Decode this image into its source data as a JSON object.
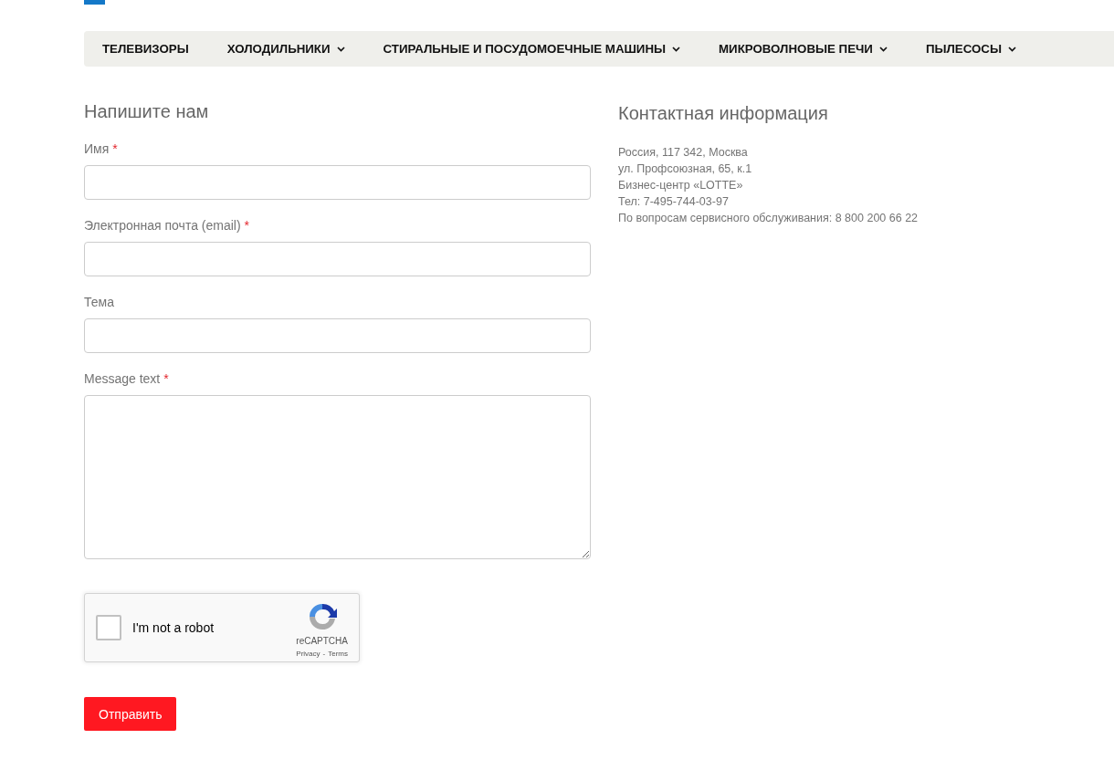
{
  "nav": [
    {
      "label": "ТЕЛЕВИЗОРЫ",
      "has_submenu": false
    },
    {
      "label": "ХОЛОДИЛЬНИКИ",
      "has_submenu": true
    },
    {
      "label": "СТИРАЛЬНЫЕ И ПОСУДОМОЕЧНЫЕ МАШИНЫ",
      "has_submenu": true
    },
    {
      "label": "МИКРОВОЛНОВЫЕ ПЕЧИ",
      "has_submenu": true
    },
    {
      "label": "ПЫЛЕСОСЫ",
      "has_submenu": true
    }
  ],
  "form": {
    "title": "Напишите нам",
    "fields": [
      {
        "kind": "input",
        "label": "Имя",
        "required_mark": "*"
      },
      {
        "kind": "input",
        "label": "Электронная почта (email)",
        "required_mark": "*"
      },
      {
        "kind": "input",
        "label": "Тема"
      },
      {
        "kind": "textarea",
        "label": "Message text",
        "required_mark": "*"
      }
    ],
    "captcha": {
      "label": "I'm not a robot",
      "checked": false,
      "brand": "reCAPTCHA",
      "links": [
        "Privacy",
        "Terms"
      ],
      "separator": "-"
    },
    "submit": "Отправить"
  },
  "contact": {
    "title": "Контактная информация",
    "lines": [
      "Россия, 117 342, Москва",
      "ул. Профсоюзная, 65, к.1",
      "Бизнес-центр «LOTTE»",
      "Тел: 7-495-744-03-97",
      "По вопросам сервисного обслуживания: 8 800 200 66 22"
    ]
  }
}
